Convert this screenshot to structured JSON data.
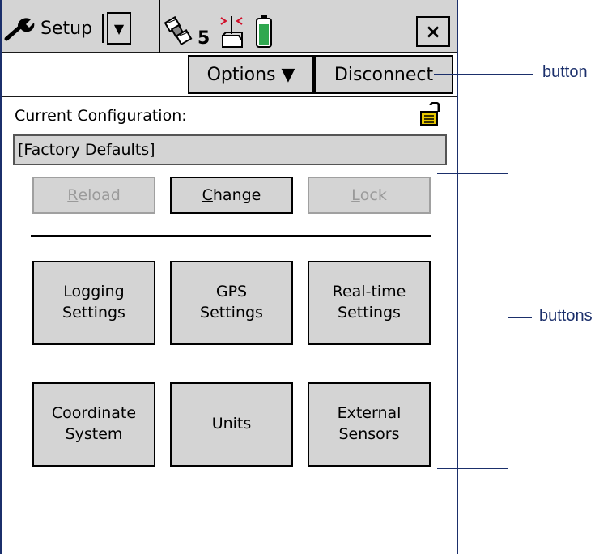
{
  "titlebar": {
    "title": "Setup",
    "dropdown_glyph": "▼",
    "satellite_count": "5",
    "close_glyph": "×",
    "icons": [
      "wrench-icon",
      "satellite-icon",
      "antenna-icon",
      "battery-icon"
    ]
  },
  "toolbar": {
    "options_label": "Options ▼",
    "disconnect_label": "Disconnect"
  },
  "config": {
    "label": "Current Configuration:",
    "value": "[Factory Defaults]"
  },
  "actions": {
    "reload": {
      "first": "R",
      "rest": "eload",
      "enabled": false
    },
    "change": {
      "first": "C",
      "rest": "hange",
      "enabled": true
    },
    "lock": {
      "first": "L",
      "rest": "ock",
      "enabled": false
    }
  },
  "settings_buttons": [
    {
      "line1": "Logging",
      "line2": "Settings"
    },
    {
      "line1": "GPS",
      "line2": "Settings"
    },
    {
      "line1": "Real-time",
      "line2": "Settings"
    },
    {
      "line1": "Coordinate",
      "line2": "System"
    },
    {
      "line1": "Units",
      "line2": ""
    },
    {
      "line1": "External",
      "line2": "Sensors"
    }
  ],
  "annotations": {
    "button": "button",
    "buttons": "buttons"
  },
  "colors": {
    "frame": "#1b2f6b",
    "button_face": "#d4d4d4",
    "lock_icon": "#e8c800",
    "battery_fill": "#2fa84f",
    "antenna": "#d0102a"
  }
}
